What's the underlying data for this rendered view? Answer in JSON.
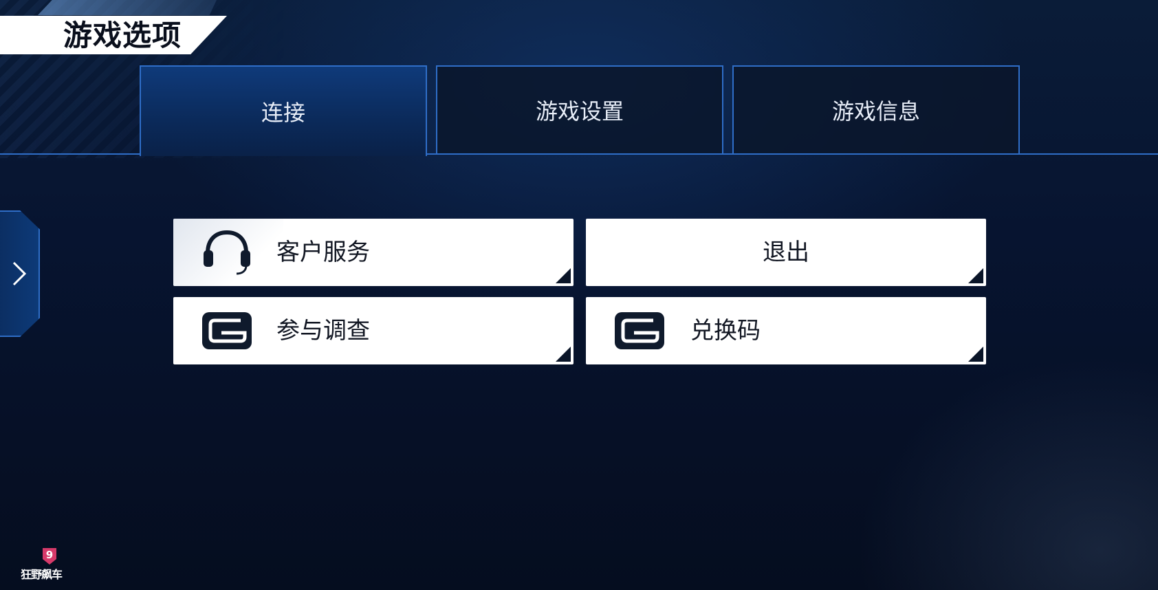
{
  "header": {
    "title": "游戏选项"
  },
  "tabs": [
    {
      "label": "连接",
      "active": true
    },
    {
      "label": "游戏设置",
      "active": false
    },
    {
      "label": "游戏信息",
      "active": false
    }
  ],
  "side_handle": {
    "icon": "chevron-right-icon"
  },
  "menu": {
    "customer_service": {
      "label": "客户服务",
      "icon": "headset-icon"
    },
    "exit": {
      "label": "退出"
    },
    "survey": {
      "label": "参与调查",
      "icon": "gameloft-logo-icon"
    },
    "redeem": {
      "label": "兑换码",
      "icon": "gameloft-logo-icon"
    }
  },
  "logo": {
    "badge": "9",
    "text": "狂野飙车"
  },
  "colors": {
    "background": "#061124",
    "accent_blue": "#2f6ec8",
    "button_bg": "#ffffff",
    "button_text": "#111622"
  }
}
